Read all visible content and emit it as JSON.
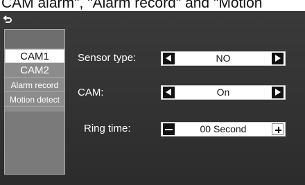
{
  "caption": "CAM alarm\", \"Alarm record\" and \"Motion",
  "back_icon": "back-arrow-icon",
  "sidebar": {
    "items": [
      {
        "label": "CAM1",
        "selected": true
      },
      {
        "label": "CAM2",
        "selected": false
      },
      {
        "label": "Alarm record",
        "selected": false
      },
      {
        "label": "Motion detect",
        "selected": false
      }
    ]
  },
  "settings": {
    "sensor_type": {
      "label": "Sensor type:",
      "value": "NO"
    },
    "cam": {
      "label": "CAM:",
      "value": "On"
    },
    "ring_time": {
      "label": "Ring time:",
      "value": "00 Second"
    }
  },
  "colors": {
    "panel_bg": "#2c2c2c",
    "sidebar_bg": "#8c8c8c",
    "selected_bg": "#ffffff",
    "control_bg": "#ffffff",
    "button_bg": "#111111"
  }
}
